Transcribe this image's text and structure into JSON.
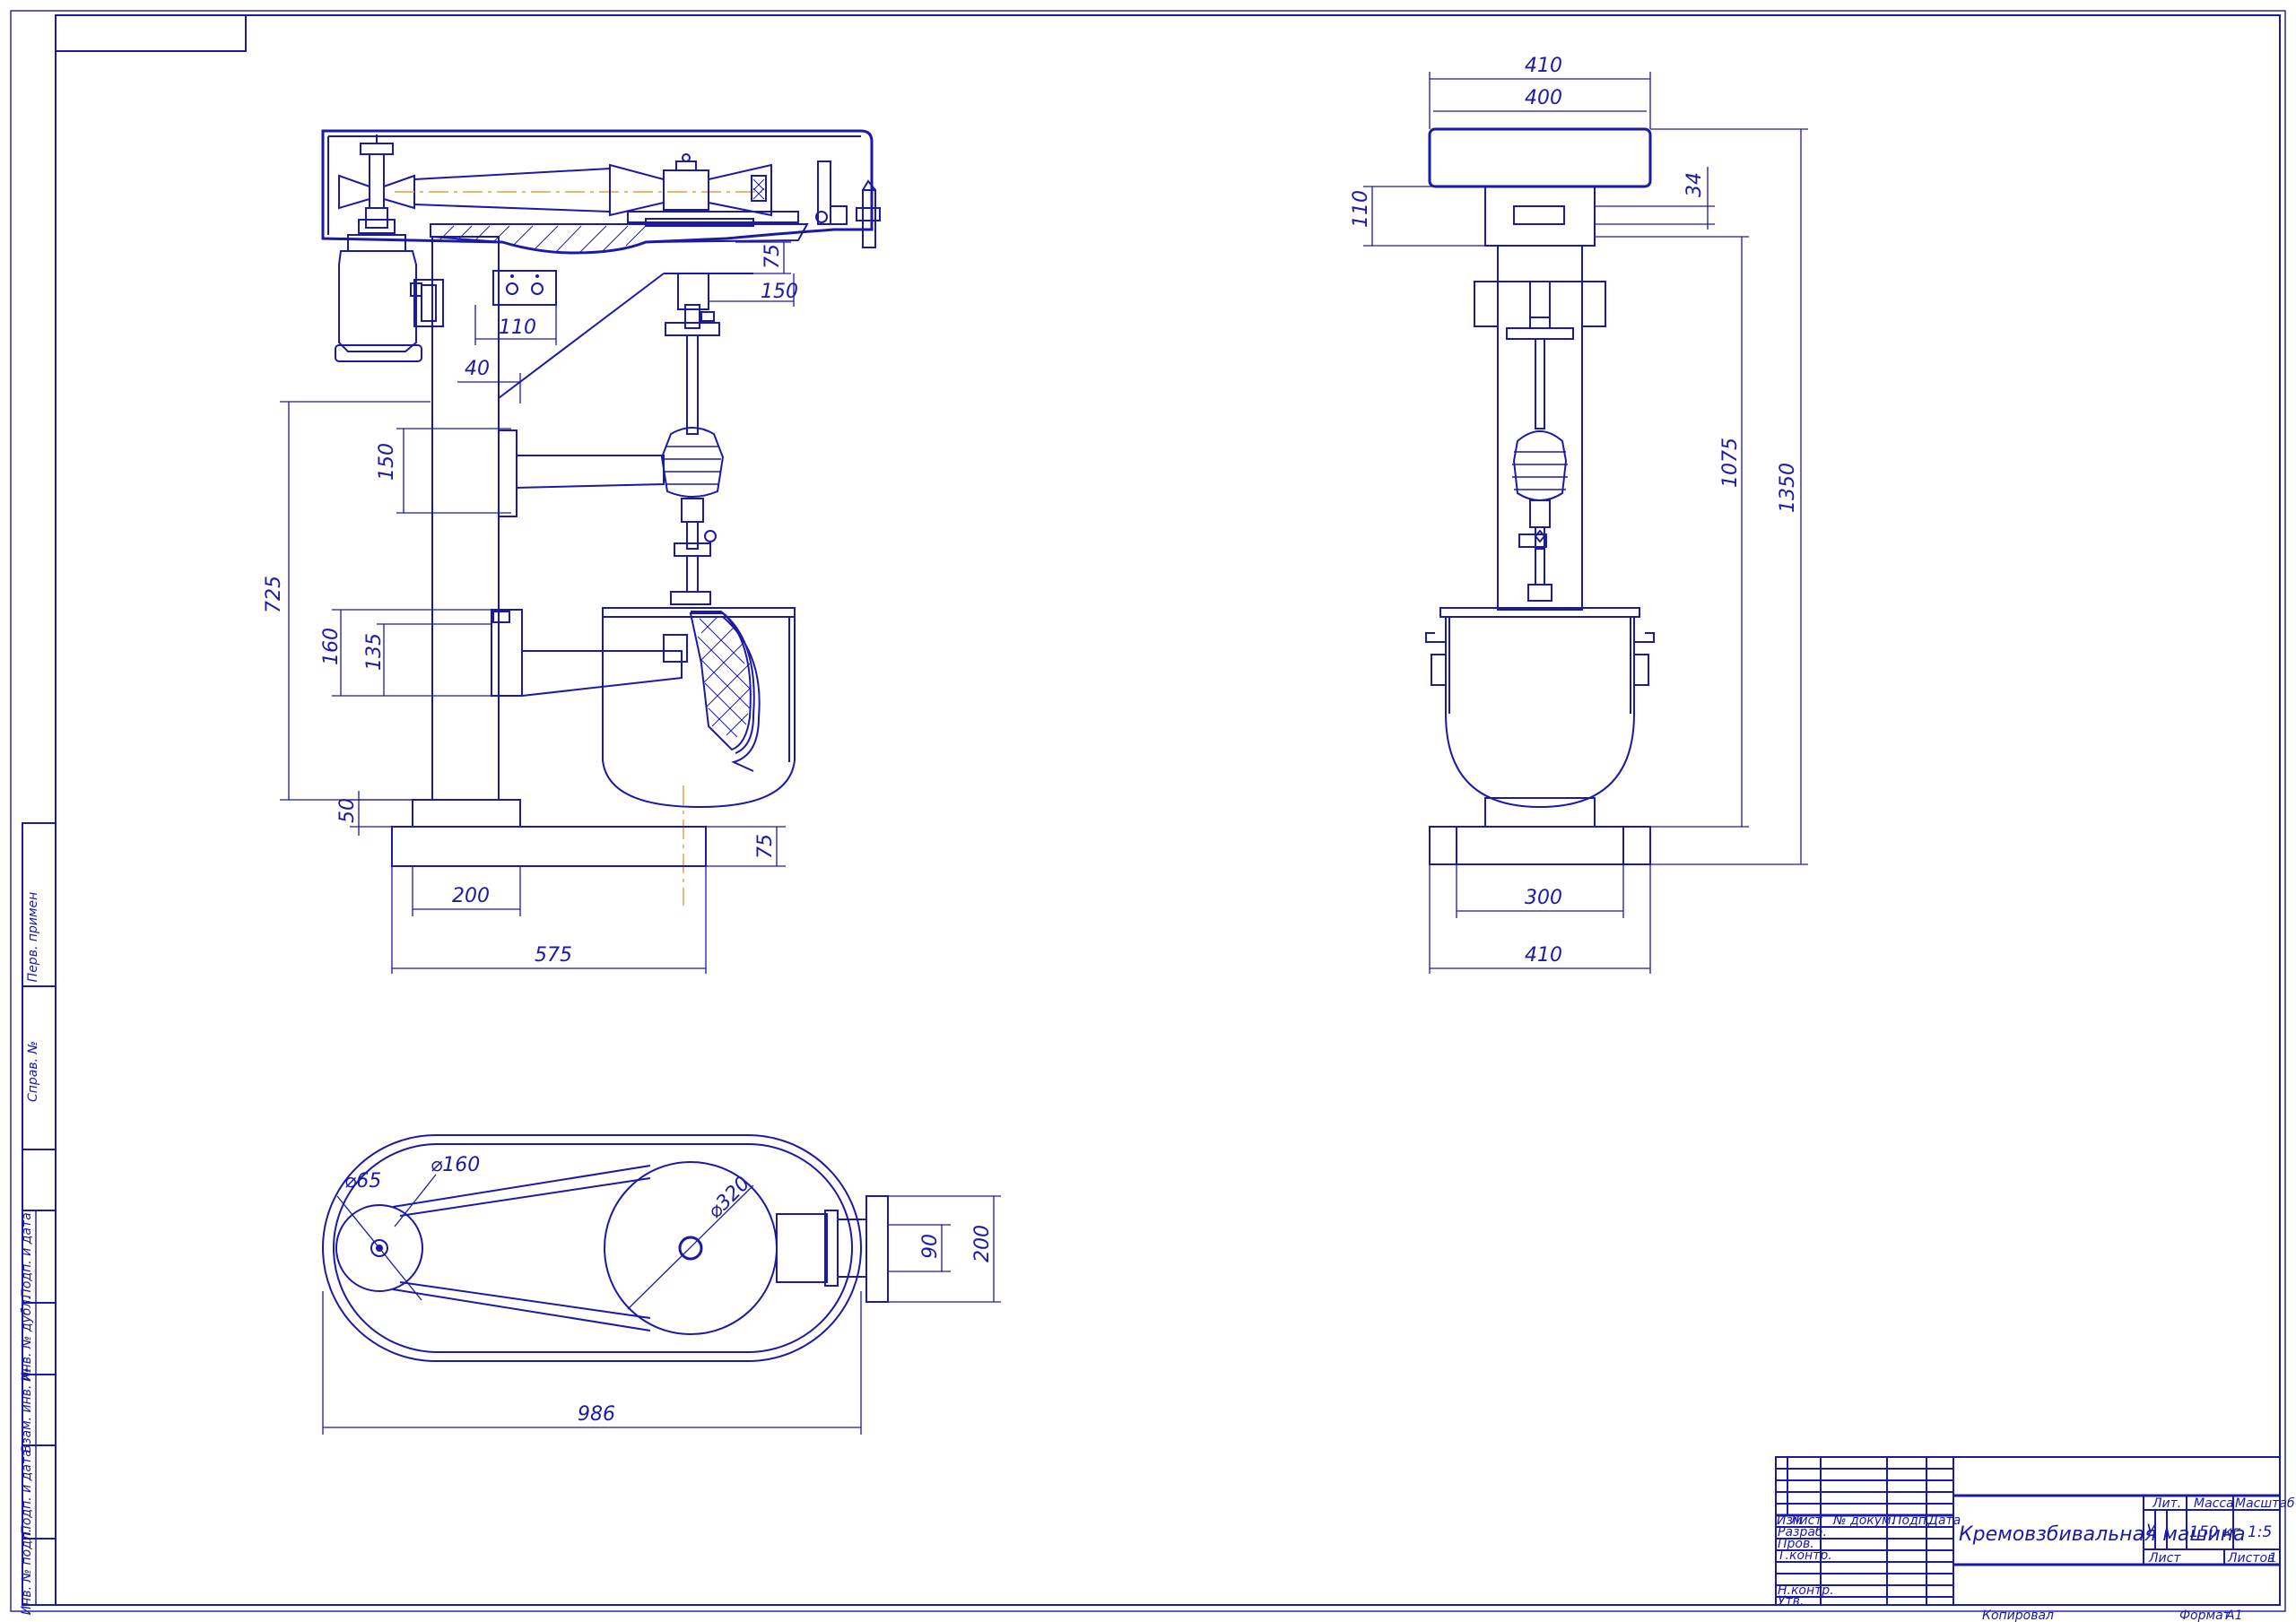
{
  "dimensions": {
    "front_top_75": "75",
    "front_150_right": "150",
    "front_110": "110",
    "front_40": "40",
    "front_150_left": "150",
    "front_725": "725",
    "front_160": "160",
    "front_135": "135",
    "front_50": "50",
    "front_75_base": "75",
    "front_200": "200",
    "front_575": "575",
    "side_410_top": "410",
    "side_400": "400",
    "side_34": "34",
    "side_110": "110",
    "side_1075": "1075",
    "side_1350": "1350",
    "side_300": "300",
    "side_410_bottom": "410",
    "plan_d65": "⌀65",
    "plan_d160": "⌀160",
    "plan_d320": "⌀320",
    "plan_90": "90",
    "plan_200": "200",
    "plan_986": "986"
  },
  "side_stamp": {
    "perv_primen": "Перв. примен",
    "sprav_no": "Справ. №",
    "podp_data_1": "Подп. и дата",
    "inv_dubl": "Инв. № дубл.",
    "vzam_inv": "Взам. инв. №",
    "podp_data_2": "Подп. и дата",
    "inv_podl": "Инв. № подл."
  },
  "title_block": {
    "col_izm": "Изм",
    "col_list": "Лист",
    "col_docum": "№ докум.",
    "col_podp": "Подп.",
    "col_data": "Дата",
    "role_razrab": "Разраб.",
    "role_prov": "Пров.",
    "role_tkontr": "Т.контр.",
    "role_nkontr": "Н.контр.",
    "role_utv": "Утв.",
    "title": "Кремовзбивальная машина",
    "lit_label": "Лит.",
    "lit_value": "У",
    "mass_label": "Масса",
    "mass_value": "150 кг",
    "scale_label": "Масштаб",
    "scale_value": "1:5",
    "sheet_label": "Лист",
    "sheets_label": "Листов",
    "sheets_value": "1",
    "copied": "Копировал",
    "format_label": "Формат",
    "format_value": "A1"
  },
  "colors": {
    "line": "#1a1aa6",
    "centerline": "#d9a441",
    "background": "#ffffff"
  }
}
